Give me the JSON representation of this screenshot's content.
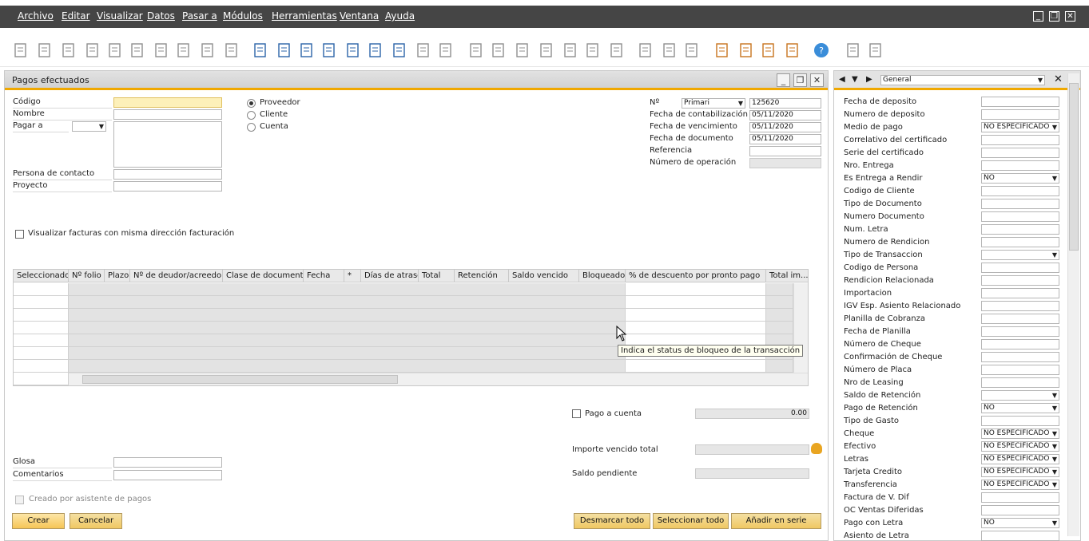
{
  "menu": {
    "items": [
      "Archivo",
      "Editar",
      "Visualizar",
      "Datos",
      "Pasar a",
      "Módulos",
      "Herramientas",
      "Ventana",
      "Ayuda"
    ],
    "window_controls": [
      "_",
      "❐",
      "✕"
    ]
  },
  "toolbar_icons": [
    "preview-icon",
    "print-icon",
    "email-icon",
    "sms-icon",
    "fax-icon",
    "excel-icon",
    "word-icon",
    "pdf-icon",
    "move-icon",
    "lock-icon",
    "find-icon",
    "add-icon",
    "first-icon",
    "prev-icon",
    "next-icon",
    "last-icon",
    "refresh-icon",
    "filter-icon",
    "sort-icon",
    "base-doc-icon",
    "target-doc-icon",
    "journal-icon",
    "payment-means-icon",
    "balance-icon",
    "document-icon",
    "settings-icon",
    "pen-icon",
    "new-doc-icon",
    "form-settings-icon",
    "messages-icon",
    "alerts-icon",
    "calendar-icon",
    "org-icon",
    "help-icon",
    "tools-icon",
    "more-icon"
  ],
  "form": {
    "title": "Pagos efectuados",
    "window_controls": [
      "_",
      "❐",
      "✕"
    ],
    "labels": {
      "codigo": "Código",
      "nombre": "Nombre",
      "pagar_a": "Pagar a",
      "persona_contacto": "Persona de contacto",
      "proyecto": "Proyecto",
      "glosa": "Glosa",
      "comentarios": "Comentarios",
      "no": "Nº",
      "fecha_contab": "Fecha de contabilización",
      "fecha_venc": "Fecha de vencimiento",
      "fecha_doc": "Fecha de documento",
      "referencia": "Referencia",
      "num_operacion": "Número de operación",
      "pago_cuenta": "Pago a cuenta",
      "importe_vencido": "Importe vencido total",
      "saldo_pendiente": "Saldo pendiente"
    },
    "radios": [
      "Proveedor",
      "Cliente",
      "Cuenta"
    ],
    "series": "Primari",
    "doc_number": "125620",
    "fecha_contab_value": "05/11/2020",
    "fecha_venc_value": "05/11/2020",
    "fecha_doc_value": "05/11/2020",
    "visualizar_facturas": "Visualizar facturas con misma dirección facturación",
    "pago_cuenta_value": "0.00",
    "creado_asistente": "Creado por asistente de pagos",
    "buttons": {
      "crear": "Crear",
      "cancelar": "Cancelar",
      "desmarcar": "Desmarcar todo",
      "seleccionar": "Seleccionar todo",
      "anadir_serie": "Añadir en serie"
    },
    "grid_columns": [
      "Seleccionado",
      "Nº folio",
      "Plazo",
      "Nº de deudor/acreedor",
      "Clase de documento",
      "Fecha",
      "*",
      "Días de atraso",
      "Total",
      "Retención",
      "Saldo vencido",
      "Bloqueado",
      "% de descuento por pronto pago",
      "Total im..."
    ],
    "tooltip": "Indica el status de bloqueo de la transacción"
  },
  "side": {
    "category": "General",
    "fields": [
      {
        "label": "Fecha de deposito",
        "value": ""
      },
      {
        "label": "Numero de deposito",
        "value": ""
      },
      {
        "label": "Medio de pago",
        "value": "NO ESPECIFICADO"
      },
      {
        "label": "Correlativo del certificado",
        "value": ""
      },
      {
        "label": "Serie del certificado",
        "value": ""
      },
      {
        "label": "Nro. Entrega",
        "value": ""
      },
      {
        "label": "Es Entrega a Rendir",
        "value": "NO"
      },
      {
        "label": "Codigo de Cliente",
        "value": ""
      },
      {
        "label": "Tipo de Documento",
        "value": ""
      },
      {
        "label": "Numero Documento",
        "value": ""
      },
      {
        "label": "Num. Letra",
        "value": ""
      },
      {
        "label": "Numero de Rendicion",
        "value": ""
      },
      {
        "label": "Tipo de Transaccion",
        "value": ""
      },
      {
        "label": "Codigo de Persona",
        "value": ""
      },
      {
        "label": "Rendicion Relacionada",
        "value": ""
      },
      {
        "label": "Importacion",
        "value": ""
      },
      {
        "label": "IGV Esp. Asiento Relacionado",
        "value": ""
      },
      {
        "label": "Planilla de Cobranza",
        "value": ""
      },
      {
        "label": "Fecha de Planilla",
        "value": ""
      },
      {
        "label": "Número de Cheque",
        "value": ""
      },
      {
        "label": "Confirmación de Cheque",
        "value": ""
      },
      {
        "label": "Número de Placa",
        "value": ""
      },
      {
        "label": "Nro de Leasing",
        "value": ""
      },
      {
        "label": "Saldo de Retención",
        "value": ""
      },
      {
        "label": "Pago de Retención",
        "value": "NO"
      },
      {
        "label": "Tipo de Gasto",
        "value": ""
      },
      {
        "label": "Cheque",
        "value": "NO ESPECIFICADO"
      },
      {
        "label": "Efectivo",
        "value": "NO ESPECIFICADO"
      },
      {
        "label": "Letras",
        "value": "NO ESPECIFICADO"
      },
      {
        "label": "Tarjeta Credito",
        "value": "NO ESPECIFICADO"
      },
      {
        "label": "Transferencia",
        "value": "NO ESPECIFICADO"
      },
      {
        "label": "Factura de V. Dif",
        "value": ""
      },
      {
        "label": "OC Ventas Diferidas",
        "value": ""
      },
      {
        "label": "Pago con Letra",
        "value": "NO"
      },
      {
        "label": "Asiento de Letra",
        "value": ""
      }
    ]
  }
}
